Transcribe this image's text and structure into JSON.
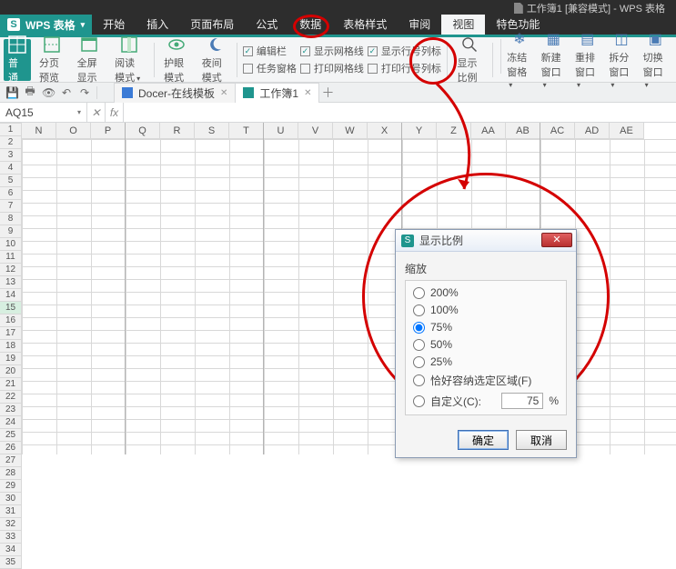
{
  "titlebar": {
    "doc": "工作簿1 [兼容模式] - WPS 表格"
  },
  "app": {
    "name": "WPS 表格"
  },
  "menu": {
    "items": [
      "开始",
      "插入",
      "页面布局",
      "公式",
      "数据",
      "表格样式",
      "审阅",
      "视图",
      "特色功能"
    ],
    "active_index": 7
  },
  "ribbon": {
    "view_buttons": [
      {
        "label": "普通"
      },
      {
        "label": "分页预览"
      },
      {
        "label": "全屏显示"
      },
      {
        "label": "阅读模式"
      }
    ],
    "mode_buttons": [
      {
        "label": "护眼模式"
      },
      {
        "label": "夜间模式"
      }
    ],
    "checks_col1": [
      {
        "label": "编辑栏",
        "checked": true
      },
      {
        "label": "任务窗格",
        "checked": false
      }
    ],
    "checks_col2": [
      {
        "label": "显示网格线",
        "checked": true
      },
      {
        "label": "打印网格线",
        "checked": false
      }
    ],
    "checks_col3": [
      {
        "label": "显示行号列标",
        "checked": true
      },
      {
        "label": "打印行号列标",
        "checked": false
      }
    ],
    "zoom_btn": "显示比例",
    "right_buttons": [
      "冻结窗格",
      "新建窗口",
      "重排窗口",
      "拆分窗口",
      "切换窗口"
    ]
  },
  "tabs": [
    {
      "label": "Docer-在线模板",
      "kind": "docer"
    },
    {
      "label": "工作簿1",
      "kind": "wps"
    }
  ],
  "namebox": "AQ15",
  "fx": "fx",
  "columns": [
    "N",
    "O",
    "P",
    "Q",
    "R",
    "S",
    "T",
    "U",
    "V",
    "W",
    "X",
    "Y",
    "Z",
    "AA",
    "AB",
    "AC",
    "AD",
    "AE"
  ],
  "rows": [
    "1",
    "2",
    "3",
    "4",
    "5",
    "6",
    "7",
    "8",
    "9",
    "10",
    "11",
    "12",
    "13",
    "14",
    "15",
    "16",
    "17",
    "18",
    "19",
    "20",
    "21",
    "22",
    "23",
    "24",
    "25",
    "26",
    "27",
    "28",
    "29",
    "30",
    "31",
    "32",
    "33",
    "34",
    "35"
  ],
  "active_row_index": 14,
  "dialog": {
    "title": "显示比例",
    "group": "缩放",
    "options": [
      "200%",
      "100%",
      "75%",
      "50%",
      "25%"
    ],
    "selected": "75%",
    "fit_label": "恰好容纳选定区域(F)",
    "custom_label": "自定义(C):",
    "custom_value": "75",
    "pct": "%",
    "ok": "确定",
    "cancel": "取消"
  }
}
